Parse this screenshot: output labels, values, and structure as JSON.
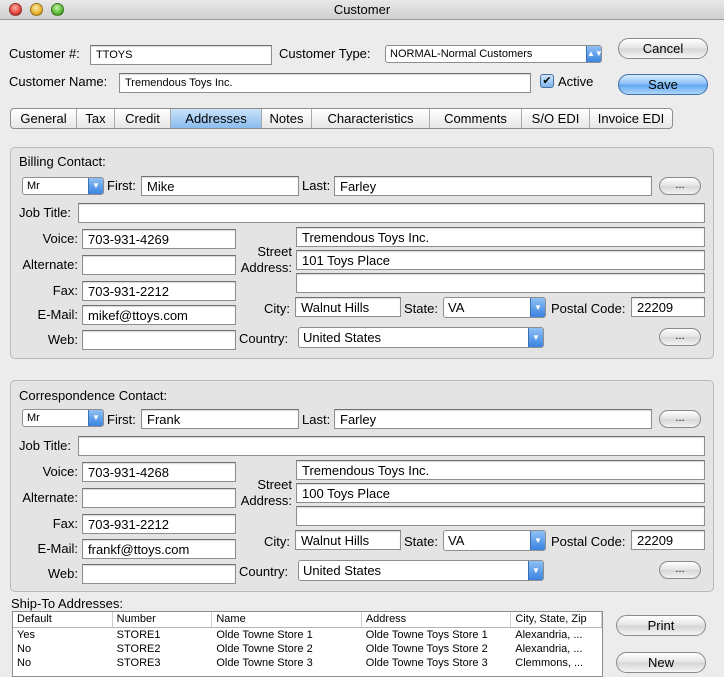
{
  "window": {
    "title": "Customer"
  },
  "header": {
    "customer_num_label": "Customer #:",
    "customer_num_value": "TTOYS",
    "customer_type_label": "Customer Type:",
    "customer_type_value": "NORMAL-Normal Customers",
    "customer_name_label": "Customer Name:",
    "customer_name_value": "Tremendous Toys Inc.",
    "active_label": "Active",
    "active_checked": true,
    "cancel_label": "Cancel",
    "save_label": "Save"
  },
  "tabs": [
    {
      "label": "General"
    },
    {
      "label": "Tax"
    },
    {
      "label": "Credit"
    },
    {
      "label": "Addresses",
      "active": true
    },
    {
      "label": "Notes"
    },
    {
      "label": "Characteristics"
    },
    {
      "label": "Comments"
    },
    {
      "label": "S/O EDI"
    },
    {
      "label": "Invoice EDI"
    }
  ],
  "labels": {
    "first": "First:",
    "last": "Last:",
    "job_title": "Job Title:",
    "voice": "Voice:",
    "alternate": "Alternate:",
    "fax": "Fax:",
    "email": "E-Mail:",
    "web": "Web:",
    "street_1": "Street",
    "street_2": "Address:",
    "city": "City:",
    "state": "State:",
    "postal": "Postal Code:",
    "country": "Country:",
    "ellipsis": "..."
  },
  "billing": {
    "title": "Billing Contact:",
    "honorific": "Mr",
    "first": "Mike",
    "last": "Farley",
    "job_title": "",
    "voice": "703-931-4269",
    "alternate": "",
    "fax": "703-931-2212",
    "email": "mikef@ttoys.com",
    "web": "",
    "address1": "Tremendous Toys Inc.",
    "address2": "101 Toys Place",
    "address3": "",
    "city": "Walnut Hills",
    "state": "VA",
    "postal": "22209",
    "country": "United States"
  },
  "correspondence": {
    "title": "Correspondence Contact:",
    "honorific": "Mr",
    "first": "Frank",
    "last": "Farley",
    "job_title": "",
    "voice": "703-931-4268",
    "alternate": "",
    "fax": "703-931-2212",
    "email": "frankf@ttoys.com",
    "web": "",
    "address1": "Tremendous Toys Inc.",
    "address2": "100 Toys Place",
    "address3": "",
    "city": "Walnut Hills",
    "state": "VA",
    "postal": "22209",
    "country": "United States"
  },
  "shipto": {
    "title": "Ship-To Addresses:",
    "columns": [
      "Default",
      "Number",
      "Name",
      "Address",
      "City, State, Zip"
    ],
    "rows": [
      [
        "Yes",
        "STORE1",
        "Olde Towne Store 1",
        "Olde Towne Toys Store 1",
        "Alexandria, ..."
      ],
      [
        "No",
        "STORE2",
        "Olde Towne Store 2",
        "Olde Towne Toys Store 2",
        "Alexandria, ..."
      ],
      [
        "No",
        "STORE3",
        "Olde Towne Store 3",
        "Olde Towne Toys Store 3",
        "Clemmons, ..."
      ]
    ],
    "print_label": "Print",
    "new_label": "New"
  }
}
